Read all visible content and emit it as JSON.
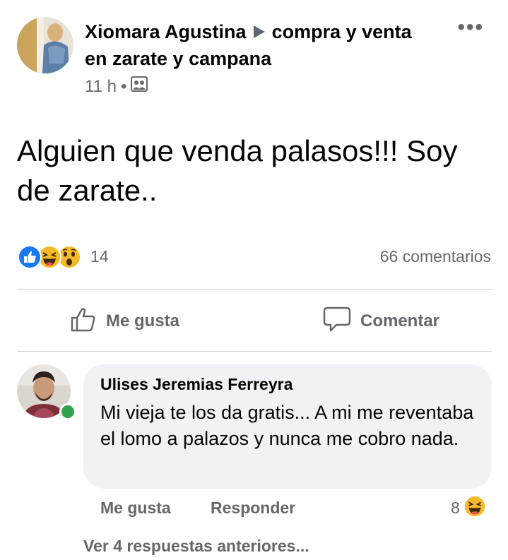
{
  "post": {
    "author": "Xiomara Agustina",
    "group": "compra y venta en zarate y campana",
    "time": "11 h",
    "separator": "•",
    "audience_icon": "group-audience-icon",
    "text": "Alguien que venda palasos!!! Soy de zarate..",
    "more_icon": "more-options-icon"
  },
  "stats": {
    "reaction_icons": [
      "like-icon",
      "haha-icon",
      "wow-icon"
    ],
    "reaction_count": "14",
    "comment_count": "66 comentarios"
  },
  "actions": {
    "like_label": "Me gusta",
    "comment_label": "Comentar"
  },
  "comment": {
    "author": "Ulises Jeremias Ferreyra",
    "text": "Mi vieja te los da gratis... A mi me reventaba  el lomo a palazos y nunca me cobro nada.",
    "like_label": "Me gusta",
    "reply_label": "Responder",
    "reaction_count": "8",
    "reaction_icon": "haha-icon",
    "online": true
  },
  "replies": {
    "label": "Ver 4 respuestas anteriores..."
  },
  "colors": {
    "like_blue": "#1877f2",
    "emoji_yellow": "#f7b928",
    "muted_text": "#65676b",
    "online_green": "#31a24c",
    "bubble_bg": "#f0f2f5"
  }
}
